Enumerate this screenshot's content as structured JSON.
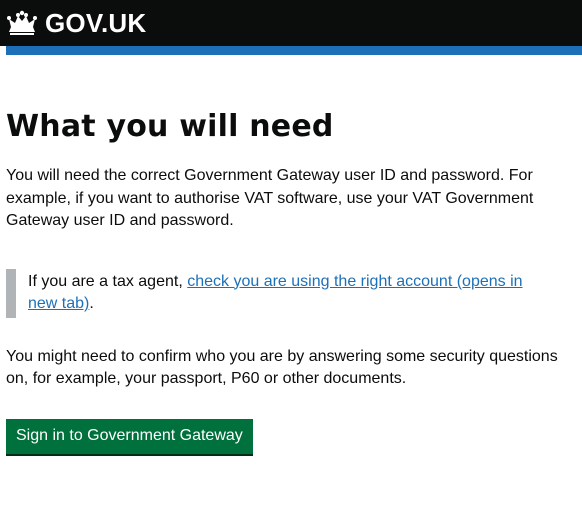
{
  "header": {
    "logo_text": "GOV.UK",
    "colors": {
      "header_bg": "#0b0c0c",
      "accent_bar": "#1d70b8"
    }
  },
  "main": {
    "title": "What you will need",
    "para1": "You will need the correct Government Gateway user ID and password. For example, if you want to authorise VAT software, use your VAT Government Gateway user ID and password.",
    "inset": {
      "prefix": "If you are a tax agent, ",
      "link_text": "check you are using the right account (opens in new tab)",
      "suffix": "."
    },
    "para2": "You might need to confirm who you are by answering some security questions on, for example, your passport, P60 or other documents.",
    "button_label": "Sign in to Government Gateway",
    "colors": {
      "button": "#00703c",
      "link": "#1d70b8",
      "inset_border": "#b1b4b6"
    }
  },
  "icons": {
    "logo_icon": "crown-icon"
  }
}
